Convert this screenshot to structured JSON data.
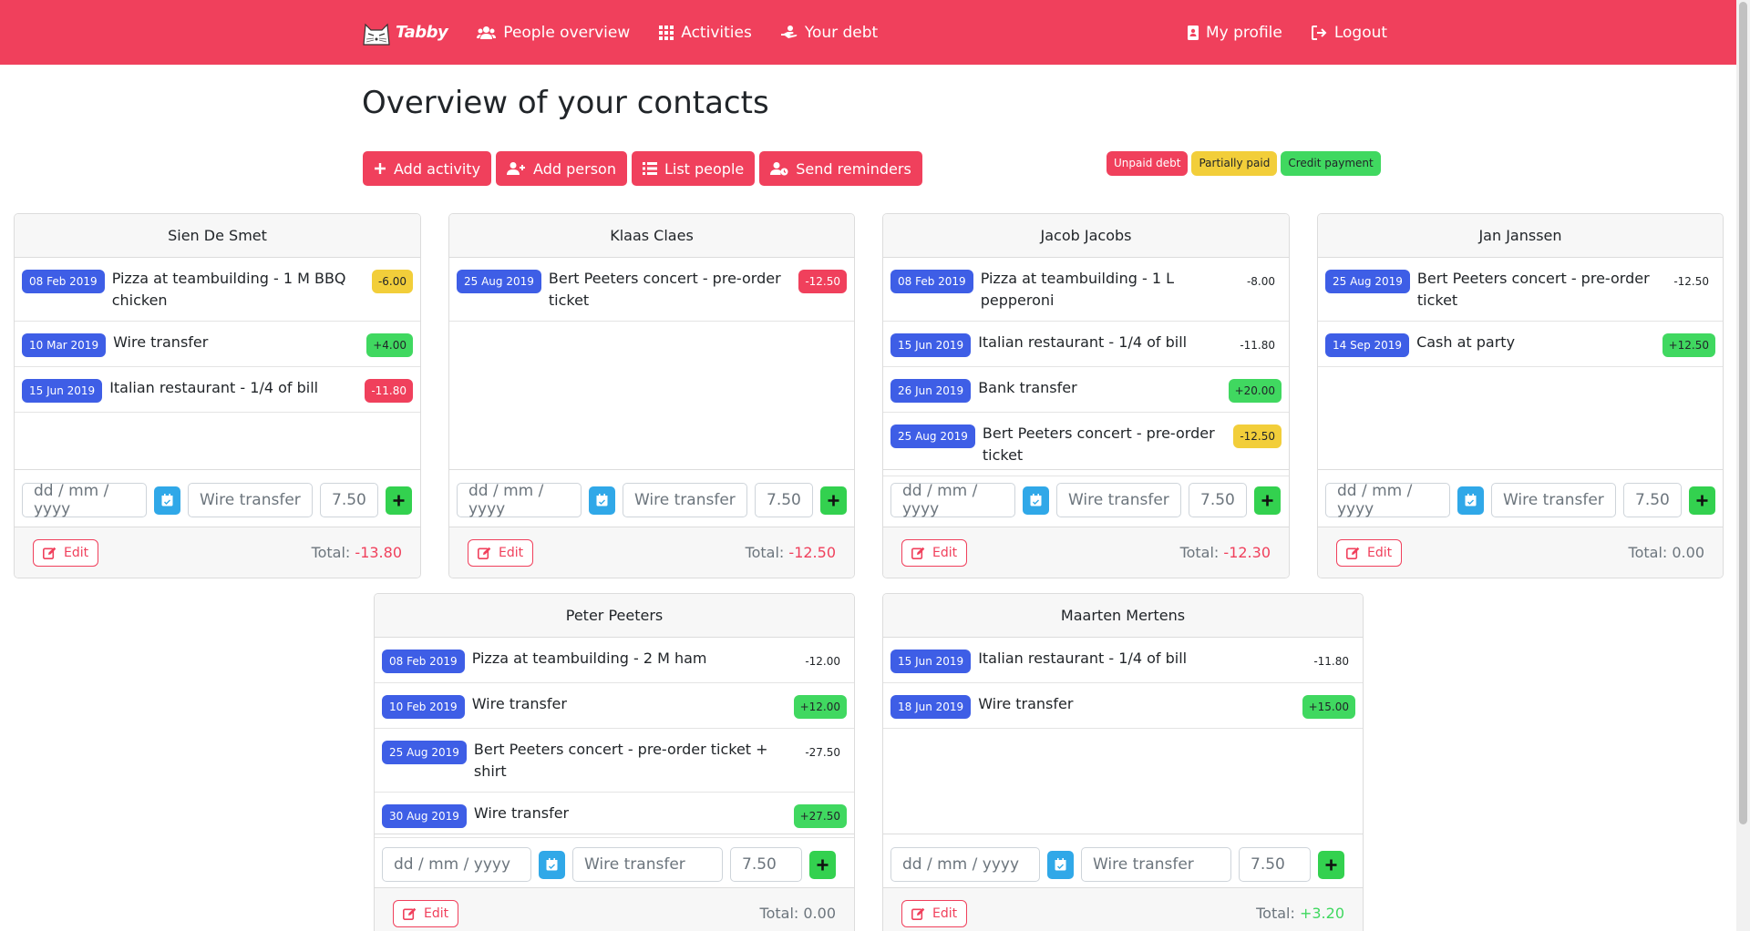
{
  "nav": {
    "brand": "Tabby",
    "links": [
      "People overview",
      "Activities",
      "Your debt"
    ],
    "right_links": [
      "My profile",
      "Logout"
    ]
  },
  "page_title": "Overview of your contacts",
  "toolbar": {
    "add_activity": "Add activity",
    "add_person": "Add person",
    "list_people": "List people",
    "send_reminders": "Send reminders"
  },
  "legend": {
    "unpaid": "Unpaid debt",
    "partial": "Partially paid",
    "credit": "Credit payment"
  },
  "colors": {
    "brand": "#f0405c",
    "date_badge": "#3e5ee6",
    "unpaid": "#f0405c",
    "partial": "#f2ce3a",
    "credit": "#40d860",
    "calendar_button": "#30a8e8",
    "add_button": "#33d14f"
  },
  "form": {
    "date_placeholder": "dd / mm / yyyy",
    "desc_placeholder": "Wire transfer",
    "amount_placeholder": "7.50",
    "edit_label": "Edit",
    "total_label": "Total:"
  },
  "people": [
    {
      "name": "Sien De Smet",
      "total": "-13.80",
      "total_status": "negative",
      "transactions": [
        {
          "date": "08 Feb 2019",
          "desc": "Pizza at teambuilding - 1 M BBQ chicken",
          "amount": "-6.00",
          "status": "partial"
        },
        {
          "date": "10 Mar 2019",
          "desc": "Wire transfer",
          "amount": "+4.00",
          "status": "credit"
        },
        {
          "date": "15 Jun 2019",
          "desc": "Italian restaurant - 1/4 of bill",
          "amount": "-11.80",
          "status": "unpaid"
        }
      ]
    },
    {
      "name": "Klaas Claes",
      "total": "-12.50",
      "total_status": "negative",
      "transactions": [
        {
          "date": "25 Aug 2019",
          "desc": "Bert Peeters concert - pre-order ticket",
          "amount": "-12.50",
          "status": "unpaid"
        }
      ]
    },
    {
      "name": "Jacob Jacobs",
      "total": "-12.30",
      "total_status": "negative",
      "transactions": [
        {
          "date": "08 Feb 2019",
          "desc": "Pizza at teambuilding - 1 L pepperoni",
          "amount": "-8.00",
          "status": "paid"
        },
        {
          "date": "15 Jun 2019",
          "desc": "Italian restaurant - 1/4 of bill",
          "amount": "-11.80",
          "status": "paid"
        },
        {
          "date": "26 Jun 2019",
          "desc": "Bank transfer",
          "amount": "+20.00",
          "status": "credit"
        },
        {
          "date": "25 Aug 2019",
          "desc": "Bert Peeters concert - pre-order ticket",
          "amount": "-12.50",
          "status": "partial"
        }
      ]
    },
    {
      "name": "Jan Janssen",
      "total": "0.00",
      "total_status": "zero",
      "transactions": [
        {
          "date": "25 Aug 2019",
          "desc": "Bert Peeters concert - pre-order ticket",
          "amount": "-12.50",
          "status": "paid"
        },
        {
          "date": "14 Sep 2019",
          "desc": "Cash at party",
          "amount": "+12.50",
          "status": "credit"
        }
      ]
    },
    {
      "name": "Peter Peeters",
      "total": "0.00",
      "total_status": "zero",
      "transactions": [
        {
          "date": "08 Feb 2019",
          "desc": "Pizza at teambuilding - 2 M ham",
          "amount": "-12.00",
          "status": "paid"
        },
        {
          "date": "10 Feb 2019",
          "desc": "Wire transfer",
          "amount": "+12.00",
          "status": "credit"
        },
        {
          "date": "25 Aug 2019",
          "desc": "Bert Peeters concert - pre-order ticket + shirt",
          "amount": "-27.50",
          "status": "paid"
        },
        {
          "date": "30 Aug 2019",
          "desc": "Wire transfer",
          "amount": "+27.50",
          "status": "credit"
        }
      ]
    },
    {
      "name": "Maarten Mertens",
      "total": "+3.20",
      "total_status": "positive",
      "transactions": [
        {
          "date": "15 Jun 2019",
          "desc": "Italian restaurant - 1/4 of bill",
          "amount": "-11.80",
          "status": "paid"
        },
        {
          "date": "18 Jun 2019",
          "desc": "Wire transfer",
          "amount": "+15.00",
          "status": "credit"
        }
      ]
    }
  ]
}
